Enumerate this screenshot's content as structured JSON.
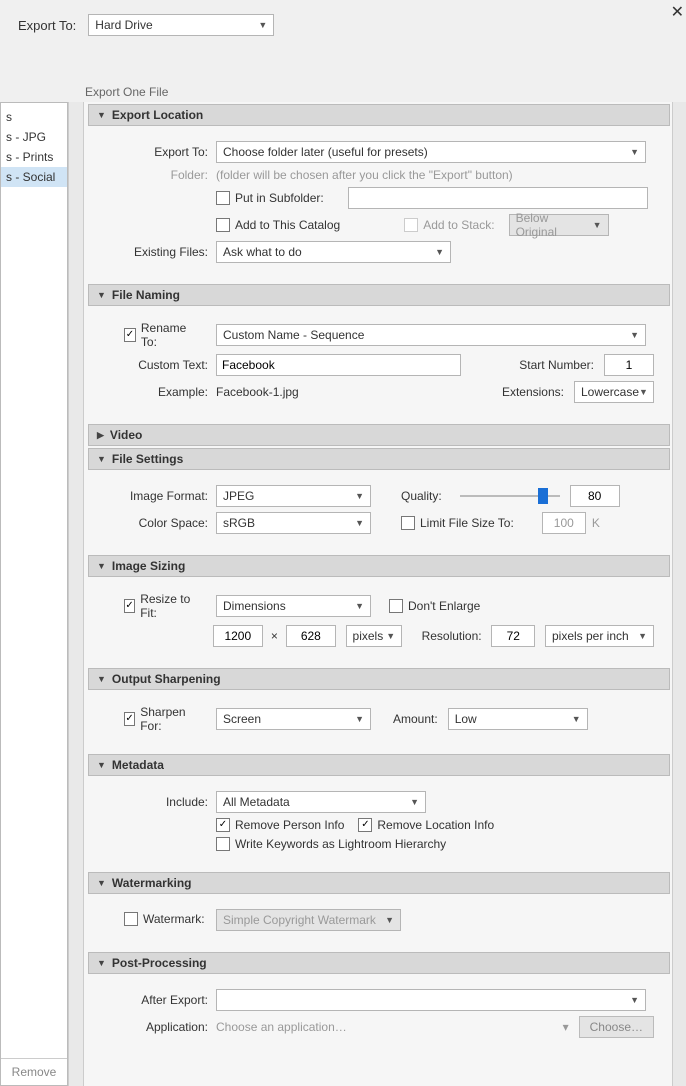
{
  "close": "✕",
  "top": {
    "label": "Export To:",
    "value": "Hard Drive"
  },
  "subtitle": "Export One File",
  "sidebar": {
    "items": [
      "s",
      "s - JPG",
      "s - Prints",
      "s - Social"
    ],
    "selected_index": 3,
    "remove": "Remove"
  },
  "sections": {
    "exportLocation": {
      "title": "Export Location",
      "exportTo_label": "Export To:",
      "exportTo_value": "Choose folder later (useful for presets)",
      "folder_label": "Folder:",
      "folder_value": "(folder will be chosen after you click the \"Export\" button)",
      "putInSubfolder": "Put in Subfolder:",
      "addToCatalog": "Add to This Catalog",
      "addToStack": "Add to Stack:",
      "belowOriginal": "Below Original",
      "existingFiles_label": "Existing Files:",
      "existingFiles_value": "Ask what to do"
    },
    "fileNaming": {
      "title": "File Naming",
      "renameTo": "Rename To:",
      "template": "Custom Name - Sequence",
      "customText_label": "Custom Text:",
      "customText_value": "Facebook",
      "startNumber_label": "Start Number:",
      "startNumber_value": "1",
      "example_label": "Example:",
      "example_value": "Facebook-1.jpg",
      "extensions_label": "Extensions:",
      "extensions_value": "Lowercase"
    },
    "video": {
      "title": "Video"
    },
    "fileSettings": {
      "title": "File Settings",
      "imageFormat_label": "Image Format:",
      "imageFormat_value": "JPEG",
      "quality_label": "Quality:",
      "quality_value": "80",
      "colorSpace_label": "Color Space:",
      "colorSpace_value": "sRGB",
      "limitFileSize": "Limit File Size To:",
      "limitFileSize_value": "100",
      "limitFileSize_unit": "K"
    },
    "imageSizing": {
      "title": "Image Sizing",
      "resizeToFit": "Resize to Fit:",
      "mode": "Dimensions",
      "dontEnlarge": "Don't Enlarge",
      "w": "1200",
      "h": "628",
      "times": "×",
      "unit": "pixels",
      "resolution_label": "Resolution:",
      "resolution_value": "72",
      "resolution_unit": "pixels per inch"
    },
    "sharpening": {
      "title": "Output Sharpening",
      "sharpenFor": "Sharpen For:",
      "sharpenFor_value": "Screen",
      "amount_label": "Amount:",
      "amount_value": "Low"
    },
    "metadata": {
      "title": "Metadata",
      "include_label": "Include:",
      "include_value": "All Metadata",
      "removePerson": "Remove Person Info",
      "removeLocation": "Remove Location Info",
      "writeKeywords": "Write Keywords as Lightroom Hierarchy"
    },
    "watermarking": {
      "title": "Watermarking",
      "watermark": "Watermark:",
      "value": "Simple Copyright Watermark"
    },
    "postProcessing": {
      "title": "Post-Processing",
      "afterExport_label": "After Export:",
      "application_label": "Application:",
      "application_placeholder": "Choose an application…",
      "choose": "Choose…"
    }
  }
}
